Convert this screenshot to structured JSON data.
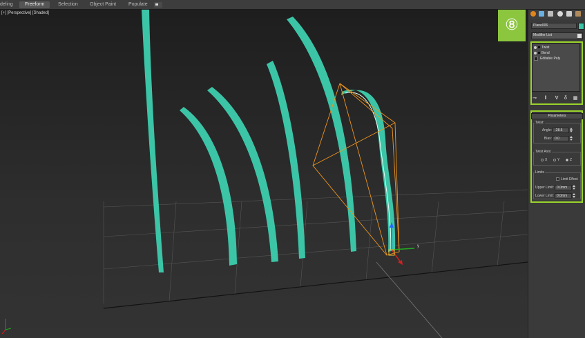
{
  "ribbon": {
    "tabs": [
      {
        "label": "deling",
        "active": false
      },
      {
        "label": "Freeform",
        "active": true
      },
      {
        "label": "Selection",
        "active": false
      },
      {
        "label": "Object Paint",
        "active": false
      },
      {
        "label": "Populate",
        "active": false
      }
    ]
  },
  "viewport": {
    "label": "[+] [Perspective] [Shaded]",
    "axes": {
      "x": "x",
      "y": "y",
      "z": "z"
    }
  },
  "badge": {
    "text": "⑧",
    "color": "#8cc63f"
  },
  "panel": {
    "tab_icons": [
      "create-icon",
      "modify-icon",
      "hierarchy-icon",
      "motion-icon",
      "display-icon",
      "utilities-icon"
    ],
    "object_name": "Plane006",
    "object_color": "#3cc4a7",
    "modifier_list": "Modifier List",
    "stack": [
      {
        "label": "Twist"
      },
      {
        "label": "Bend"
      },
      {
        "label": "Editable Poly"
      }
    ],
    "rollout_title": "Parameters",
    "twist": {
      "group": "Twist:",
      "angle_label": "Angle:",
      "angle_value": "-28.5",
      "bias_label": "Bias:",
      "bias_value": "0.0"
    },
    "axis": {
      "group": "Twist Axis:",
      "x": "X",
      "y": "Y",
      "z": "Z",
      "selected": "Z"
    },
    "limits": {
      "group": "Limits",
      "limit_effect": "Limit Effect",
      "upper_label": "Upper Limit:",
      "upper_value": "0.0mm",
      "lower_label": "Lower Limit:",
      "lower_value": "0.0mm"
    }
  },
  "highlight_color": "#9bd52b"
}
